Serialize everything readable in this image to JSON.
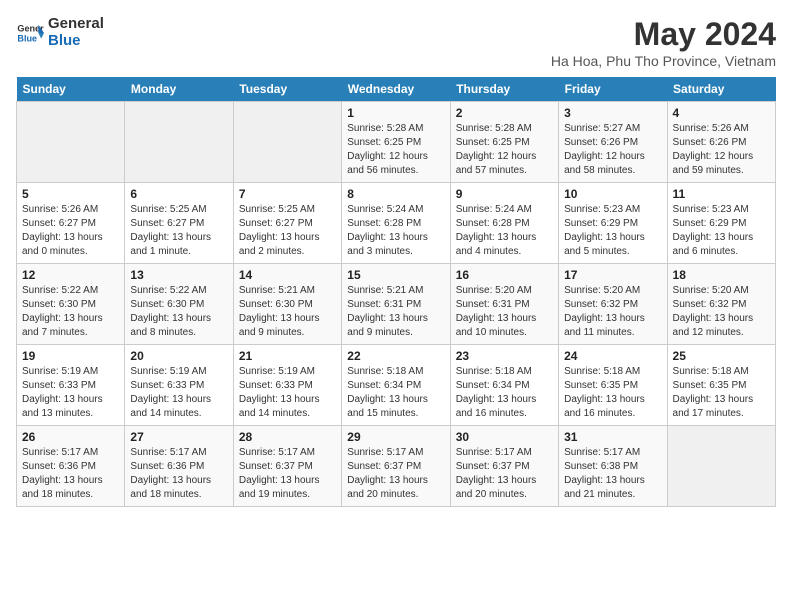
{
  "header": {
    "logo_line1": "General",
    "logo_line2": "Blue",
    "month_year": "May 2024",
    "location": "Ha Hoa, Phu Tho Province, Vietnam"
  },
  "days_of_week": [
    "Sunday",
    "Monday",
    "Tuesday",
    "Wednesday",
    "Thursday",
    "Friday",
    "Saturday"
  ],
  "weeks": [
    [
      {
        "day": "",
        "info": ""
      },
      {
        "day": "",
        "info": ""
      },
      {
        "day": "",
        "info": ""
      },
      {
        "day": "1",
        "info": "Sunrise: 5:28 AM\nSunset: 6:25 PM\nDaylight: 12 hours\nand 56 minutes."
      },
      {
        "day": "2",
        "info": "Sunrise: 5:28 AM\nSunset: 6:25 PM\nDaylight: 12 hours\nand 57 minutes."
      },
      {
        "day": "3",
        "info": "Sunrise: 5:27 AM\nSunset: 6:26 PM\nDaylight: 12 hours\nand 58 minutes."
      },
      {
        "day": "4",
        "info": "Sunrise: 5:26 AM\nSunset: 6:26 PM\nDaylight: 12 hours\nand 59 minutes."
      }
    ],
    [
      {
        "day": "5",
        "info": "Sunrise: 5:26 AM\nSunset: 6:27 PM\nDaylight: 13 hours\nand 0 minutes."
      },
      {
        "day": "6",
        "info": "Sunrise: 5:25 AM\nSunset: 6:27 PM\nDaylight: 13 hours\nand 1 minute."
      },
      {
        "day": "7",
        "info": "Sunrise: 5:25 AM\nSunset: 6:27 PM\nDaylight: 13 hours\nand 2 minutes."
      },
      {
        "day": "8",
        "info": "Sunrise: 5:24 AM\nSunset: 6:28 PM\nDaylight: 13 hours\nand 3 minutes."
      },
      {
        "day": "9",
        "info": "Sunrise: 5:24 AM\nSunset: 6:28 PM\nDaylight: 13 hours\nand 4 minutes."
      },
      {
        "day": "10",
        "info": "Sunrise: 5:23 AM\nSunset: 6:29 PM\nDaylight: 13 hours\nand 5 minutes."
      },
      {
        "day": "11",
        "info": "Sunrise: 5:23 AM\nSunset: 6:29 PM\nDaylight: 13 hours\nand 6 minutes."
      }
    ],
    [
      {
        "day": "12",
        "info": "Sunrise: 5:22 AM\nSunset: 6:30 PM\nDaylight: 13 hours\nand 7 minutes."
      },
      {
        "day": "13",
        "info": "Sunrise: 5:22 AM\nSunset: 6:30 PM\nDaylight: 13 hours\nand 8 minutes."
      },
      {
        "day": "14",
        "info": "Sunrise: 5:21 AM\nSunset: 6:30 PM\nDaylight: 13 hours\nand 9 minutes."
      },
      {
        "day": "15",
        "info": "Sunrise: 5:21 AM\nSunset: 6:31 PM\nDaylight: 13 hours\nand 9 minutes."
      },
      {
        "day": "16",
        "info": "Sunrise: 5:20 AM\nSunset: 6:31 PM\nDaylight: 13 hours\nand 10 minutes."
      },
      {
        "day": "17",
        "info": "Sunrise: 5:20 AM\nSunset: 6:32 PM\nDaylight: 13 hours\nand 11 minutes."
      },
      {
        "day": "18",
        "info": "Sunrise: 5:20 AM\nSunset: 6:32 PM\nDaylight: 13 hours\nand 12 minutes."
      }
    ],
    [
      {
        "day": "19",
        "info": "Sunrise: 5:19 AM\nSunset: 6:33 PM\nDaylight: 13 hours\nand 13 minutes."
      },
      {
        "day": "20",
        "info": "Sunrise: 5:19 AM\nSunset: 6:33 PM\nDaylight: 13 hours\nand 14 minutes."
      },
      {
        "day": "21",
        "info": "Sunrise: 5:19 AM\nSunset: 6:33 PM\nDaylight: 13 hours\nand 14 minutes."
      },
      {
        "day": "22",
        "info": "Sunrise: 5:18 AM\nSunset: 6:34 PM\nDaylight: 13 hours\nand 15 minutes."
      },
      {
        "day": "23",
        "info": "Sunrise: 5:18 AM\nSunset: 6:34 PM\nDaylight: 13 hours\nand 16 minutes."
      },
      {
        "day": "24",
        "info": "Sunrise: 5:18 AM\nSunset: 6:35 PM\nDaylight: 13 hours\nand 16 minutes."
      },
      {
        "day": "25",
        "info": "Sunrise: 5:18 AM\nSunset: 6:35 PM\nDaylight: 13 hours\nand 17 minutes."
      }
    ],
    [
      {
        "day": "26",
        "info": "Sunrise: 5:17 AM\nSunset: 6:36 PM\nDaylight: 13 hours\nand 18 minutes."
      },
      {
        "day": "27",
        "info": "Sunrise: 5:17 AM\nSunset: 6:36 PM\nDaylight: 13 hours\nand 18 minutes."
      },
      {
        "day": "28",
        "info": "Sunrise: 5:17 AM\nSunset: 6:37 PM\nDaylight: 13 hours\nand 19 minutes."
      },
      {
        "day": "29",
        "info": "Sunrise: 5:17 AM\nSunset: 6:37 PM\nDaylight: 13 hours\nand 20 minutes."
      },
      {
        "day": "30",
        "info": "Sunrise: 5:17 AM\nSunset: 6:37 PM\nDaylight: 13 hours\nand 20 minutes."
      },
      {
        "day": "31",
        "info": "Sunrise: 5:17 AM\nSunset: 6:38 PM\nDaylight: 13 hours\nand 21 minutes."
      },
      {
        "day": "",
        "info": ""
      }
    ]
  ]
}
